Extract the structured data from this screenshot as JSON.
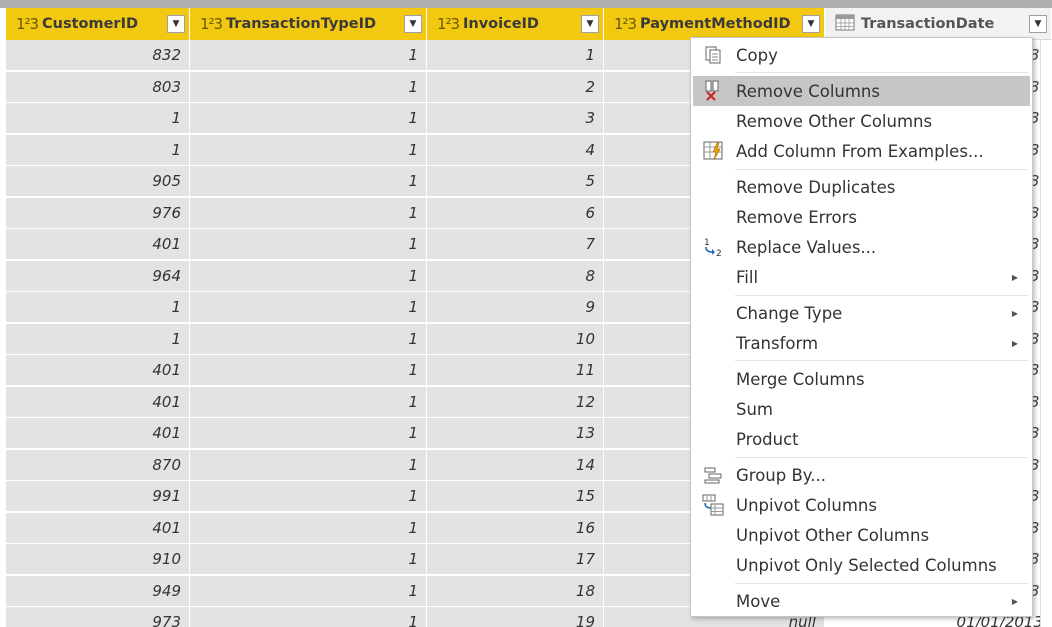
{
  "columns": [
    {
      "type_icon": "1²3",
      "name": "CustomerID"
    },
    {
      "type_icon": "1²3",
      "name": "TransactionTypeID"
    },
    {
      "type_icon": "1²3",
      "name": "InvoiceID"
    },
    {
      "type_icon": "1²3",
      "name": "PaymentMethodID"
    },
    {
      "type_icon": "calendar-icon",
      "name": "TransactionDate"
    }
  ],
  "rows": [
    {
      "customer": "832",
      "type": "1",
      "invoice": "1",
      "date_tail": "3"
    },
    {
      "customer": "803",
      "type": "1",
      "invoice": "2",
      "date_tail": "3"
    },
    {
      "customer": "1",
      "type": "1",
      "invoice": "3",
      "date_tail": "3"
    },
    {
      "customer": "1",
      "type": "1",
      "invoice": "4",
      "date_tail": "3"
    },
    {
      "customer": "905",
      "type": "1",
      "invoice": "5",
      "date_tail": "3"
    },
    {
      "customer": "976",
      "type": "1",
      "invoice": "6",
      "date_tail": "3"
    },
    {
      "customer": "401",
      "type": "1",
      "invoice": "7",
      "date_tail": "3"
    },
    {
      "customer": "964",
      "type": "1",
      "invoice": "8",
      "date_tail": "3"
    },
    {
      "customer": "1",
      "type": "1",
      "invoice": "9",
      "date_tail": "3"
    },
    {
      "customer": "1",
      "type": "1",
      "invoice": "10",
      "date_tail": "3"
    },
    {
      "customer": "401",
      "type": "1",
      "invoice": "11",
      "date_tail": "3"
    },
    {
      "customer": "401",
      "type": "1",
      "invoice": "12",
      "date_tail": "3"
    },
    {
      "customer": "401",
      "type": "1",
      "invoice": "13",
      "date_tail": "3"
    },
    {
      "customer": "870",
      "type": "1",
      "invoice": "14",
      "date_tail": "3"
    },
    {
      "customer": "991",
      "type": "1",
      "invoice": "15",
      "date_tail": "3"
    },
    {
      "customer": "401",
      "type": "1",
      "invoice": "16",
      "date_tail": "3"
    },
    {
      "customer": "910",
      "type": "1",
      "invoice": "17",
      "date_tail": "3"
    },
    {
      "customer": "949",
      "type": "1",
      "invoice": "18",
      "date_tail": "3"
    },
    {
      "customer": "973",
      "type": "1",
      "invoice": "19",
      "payment": "null",
      "date": "01/01/2013"
    }
  ],
  "context_menu": {
    "items": [
      {
        "label": "Copy",
        "icon": "copy-icon"
      },
      {
        "label": "Remove Columns",
        "icon": "remove-columns-icon",
        "hover": true
      },
      {
        "label": "Remove Other Columns",
        "icon": ""
      },
      {
        "label": "Add Column From Examples...",
        "icon": "add-column-examples-icon"
      },
      {
        "label": "Remove Duplicates",
        "icon": ""
      },
      {
        "label": "Remove Errors",
        "icon": ""
      },
      {
        "label": "Replace Values...",
        "icon": "replace-values-icon"
      },
      {
        "label": "Fill",
        "icon": "",
        "submenu": true
      },
      {
        "label": "Change Type",
        "icon": "",
        "submenu": true
      },
      {
        "label": "Transform",
        "icon": "",
        "submenu": true
      },
      {
        "label": "Merge Columns",
        "icon": ""
      },
      {
        "label": "Sum",
        "icon": ""
      },
      {
        "label": "Product",
        "icon": ""
      },
      {
        "label": "Group By...",
        "icon": "group-by-icon"
      },
      {
        "label": "Unpivot Columns",
        "icon": "unpivot-columns-icon"
      },
      {
        "label": "Unpivot Other Columns",
        "icon": ""
      },
      {
        "label": "Unpivot Only Selected Columns",
        "icon": ""
      },
      {
        "label": "Move",
        "icon": "",
        "submenu": true
      }
    ]
  },
  "colors": {
    "selected_header": "#f2c811",
    "selected_cell": "#e3e3e3",
    "menu_hover": "#c6c6c6"
  }
}
